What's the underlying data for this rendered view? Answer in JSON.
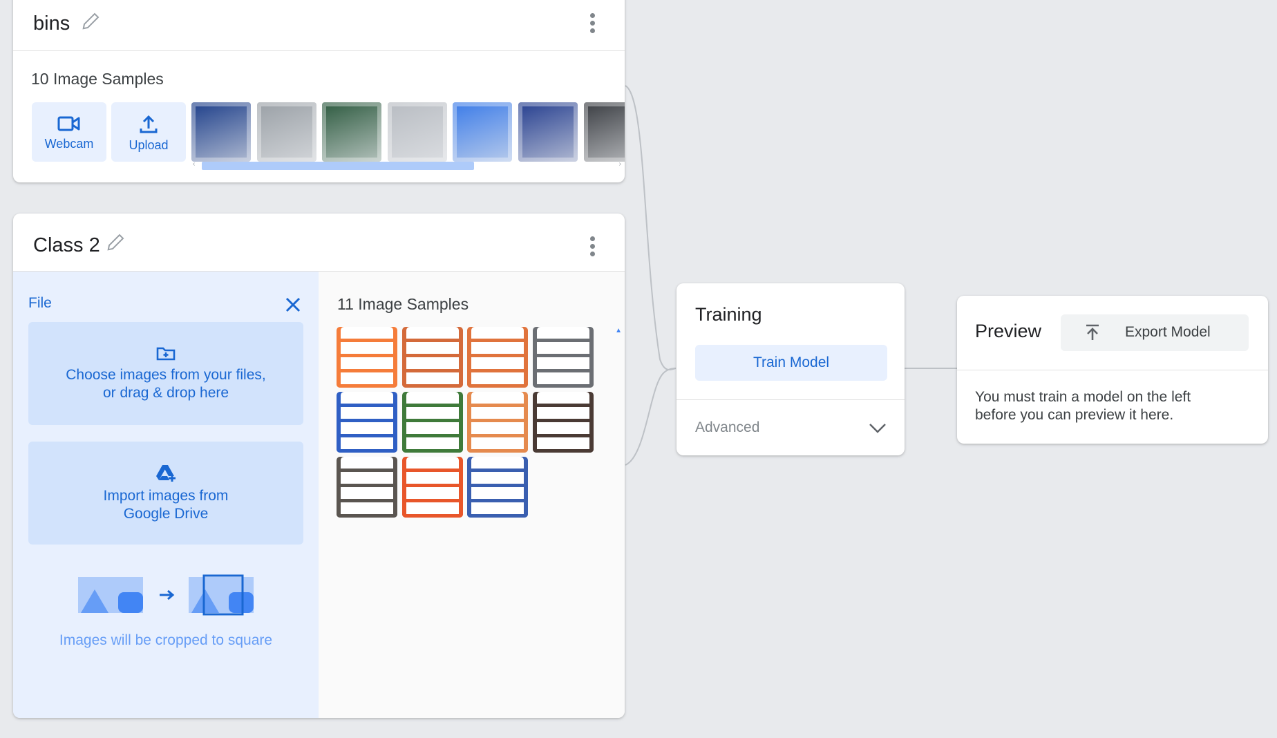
{
  "class1": {
    "title": "bins",
    "samples_label": "10 Image Samples",
    "webcam_label": "Webcam",
    "upload_label": "Upload",
    "thumbs": [
      "#1e3f8a",
      "#9aa0a6",
      "#2d5a3f",
      "#b8bcc2",
      "#3b7be8",
      "#253e8f",
      "#3a3d42"
    ]
  },
  "class2": {
    "title": "Class 2",
    "uploader": {
      "file_label": "File",
      "choose_line1": "Choose images from your files,",
      "choose_line2": "or drag & drop here",
      "drive_line1": "Import images from",
      "drive_line2": "Google Drive",
      "crop_note": "Images will be cropped to square"
    },
    "samples_label": "11 Image Samples",
    "thumbs": [
      "#f57c3a",
      "#d46a3a",
      "#e0733c",
      "#6b6e73",
      "#2f5fc4",
      "#3f7a3a",
      "#e58a4e",
      "#4a3a34",
      "#5a5550",
      "#e8562a",
      "#3a5fb0"
    ]
  },
  "training": {
    "title": "Training",
    "train_button": "Train Model",
    "advanced_label": "Advanced"
  },
  "preview": {
    "title": "Preview",
    "export_button": "Export Model",
    "message_line1": "You must train a model on the left",
    "message_line2": "before you can preview it here."
  },
  "colors": {
    "accent": "#1967d2",
    "accent_light": "#e8f0fe",
    "background": "#e8eaed"
  }
}
